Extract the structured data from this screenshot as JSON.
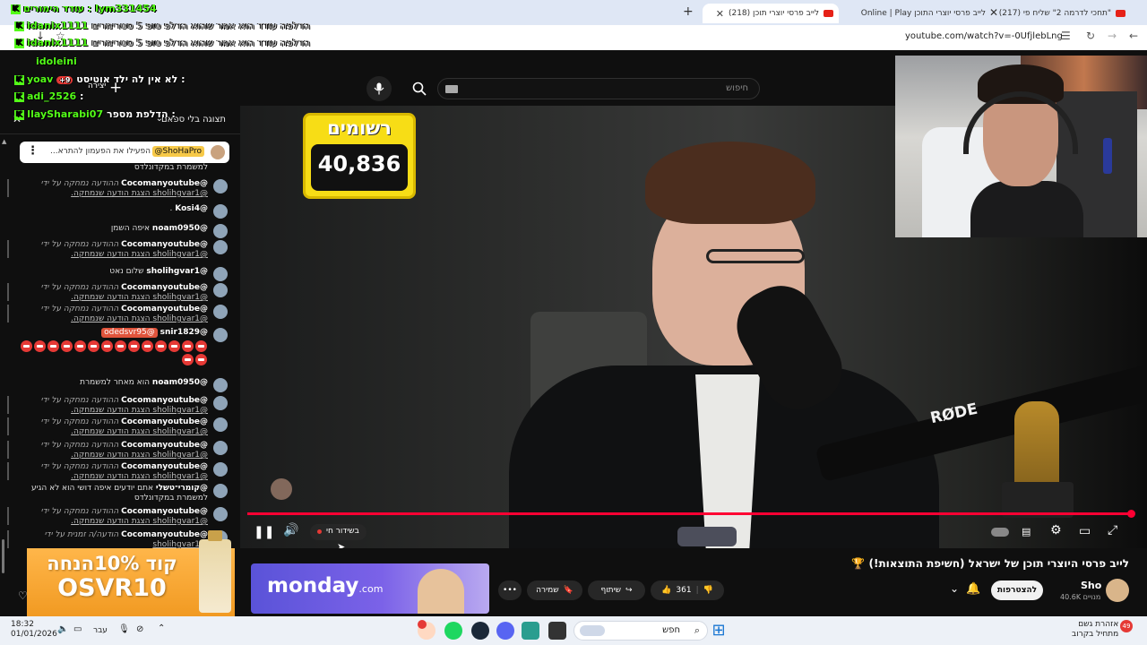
{
  "browser": {
    "tabs": [
      {
        "label": "\"תחכי לדרמה 2\" שליח פי (217)"
      },
      {
        "label": "לייב פרסי יוצרי התוכן Online | Play"
      },
      {
        "label": "לייב פרסי יוצרי תוכן (218)"
      }
    ],
    "url": "youtube.com/watch?v=-0UfjlebLng"
  },
  "overlay": {
    "line1_user": "עודד הימורים : Iym331454",
    "line2_user": "idanix1111",
    "line2_text": "הדלפה עודד הוא אמר שהוא הדלפ טופ 5 סטרימרים",
    "line3_user": "idanix1111",
    "line3_text": "הדלפה עודד הוא אמר שהוא הדלפ טופ 5 סטרימרים",
    "line4_user": "idoleini",
    "line5_user": "yoav",
    "line5_text": "לא אין לה ילד אוטיסט :",
    "line6_user": "adi_2526",
    "line7_user": "IlaySharabi07",
    "line7_text": "הדלפת מספר :",
    "badge_count": "+9"
  },
  "youtube": {
    "search_placeholder": "חיפוש",
    "create_label": "יצירה"
  },
  "chat": {
    "header_title": "תצוגה בלי ספאם",
    "pinned_author": "@ShoHaPro",
    "pinned_text": "...הפעילו את הפעמון להתרא",
    "messages": [
      {
        "author": "",
        "text": "למשמרת במקדונלדס"
      },
      {
        "author": "@Cocomanyoutube",
        "text": "ההודעה נמחקה על ידי",
        "sub": "@sholihgvar1 הצגת הודעה שנמחקה."
      },
      {
        "author": "@Kosi4",
        "text": "."
      },
      {
        "author": "@noam0950",
        "text": "איפה השמן"
      },
      {
        "author": "@Cocomanyoutube",
        "text": "ההודעה נמחקה על ידי",
        "sub": "@sholihgvar1 הצגת הודעה שנמחקה."
      },
      {
        "author": "@sholihgvar1",
        "text": "שלום נאט"
      },
      {
        "author": "@Cocomanyoutube",
        "text": "ההודעה נמחקה על ידי",
        "sub": "@sholihgvar1 הצגת הודעה שנמחקה."
      },
      {
        "author": "@Cocomanyoutube",
        "text": "ההודעה נמחקה על ידי",
        "sub": "@sholihgvar1 הצגת הודעה שנמחקה."
      },
      {
        "author": "@snir1829",
        "text": "@odedsvr95"
      },
      {
        "author": "@noam0950",
        "text": "הוא מאחר למשמרת"
      },
      {
        "author": "@Cocomanyoutube",
        "text": "ההודעה נמחקה על ידי",
        "sub": "@sholihgvar1 הצגת הודעה שנמחקה."
      },
      {
        "author": "@Cocomanyoutube",
        "text": "ההודעה נמחקה על ידי",
        "sub": "@sholihgvar1 הצגת הודעה שנמחקה."
      },
      {
        "author": "@Cocomanyoutube",
        "text": "ההודעה נמחקה על ידי",
        "sub": "@sholihgvar1 הצגת הודעה שנמחקה."
      },
      {
        "author": "@Cocomanyoutube",
        "text": "ההודעה נמחקה על ידי",
        "sub": "@sholihgvar1 הצגת הודעה שנמחקה."
      },
      {
        "author": "@קומרי־טשלי",
        "text": "אתם יודעים איפה דושי הוא לא הגיע",
        "sub": "למשמרת במקדונלדס"
      },
      {
        "author": "@Cocomanyoutube",
        "text": "ההודעה נמחקה על ידי",
        "sub": "@sholihgvar1 הצגת הודעה שנמחקה."
      },
      {
        "author": "@Cocomanyoutube",
        "text": "הודעה/ה זמנית על ידי",
        "sub": "@sholihgvar1"
      }
    ],
    "promo_line1": "קוד 10%הנחה",
    "promo_line2": "OSVR10"
  },
  "video": {
    "subs_label": "רשומים",
    "subs_count": "40,836",
    "live_label": "בשידור חי",
    "title": "לייב פרסי היוצרי תוכן של ישראל (חשיפת התוצאות!) 🏆",
    "channel_name": "Sho",
    "channel_subs": "40.6K מנויים",
    "join_label": "להצטרפות",
    "likes": "361",
    "share_label": "שיתוף",
    "save_label": "שמירה",
    "ad_brand": "monday",
    "ad_suffix": ".com",
    "rode_label": "RØDE"
  },
  "taskbar": {
    "time": "18:32",
    "date": "01/01/2026",
    "lang": "עבר",
    "search_placeholder": "חפש",
    "weather_title": "אזהרת גשם",
    "weather_sub": "מתחיל בקרוב",
    "notif_count": "49"
  },
  "colors": {
    "youtube_red": "#ff0033",
    "kick_green": "#53fc18",
    "subs_yellow": "#f7dd16"
  }
}
